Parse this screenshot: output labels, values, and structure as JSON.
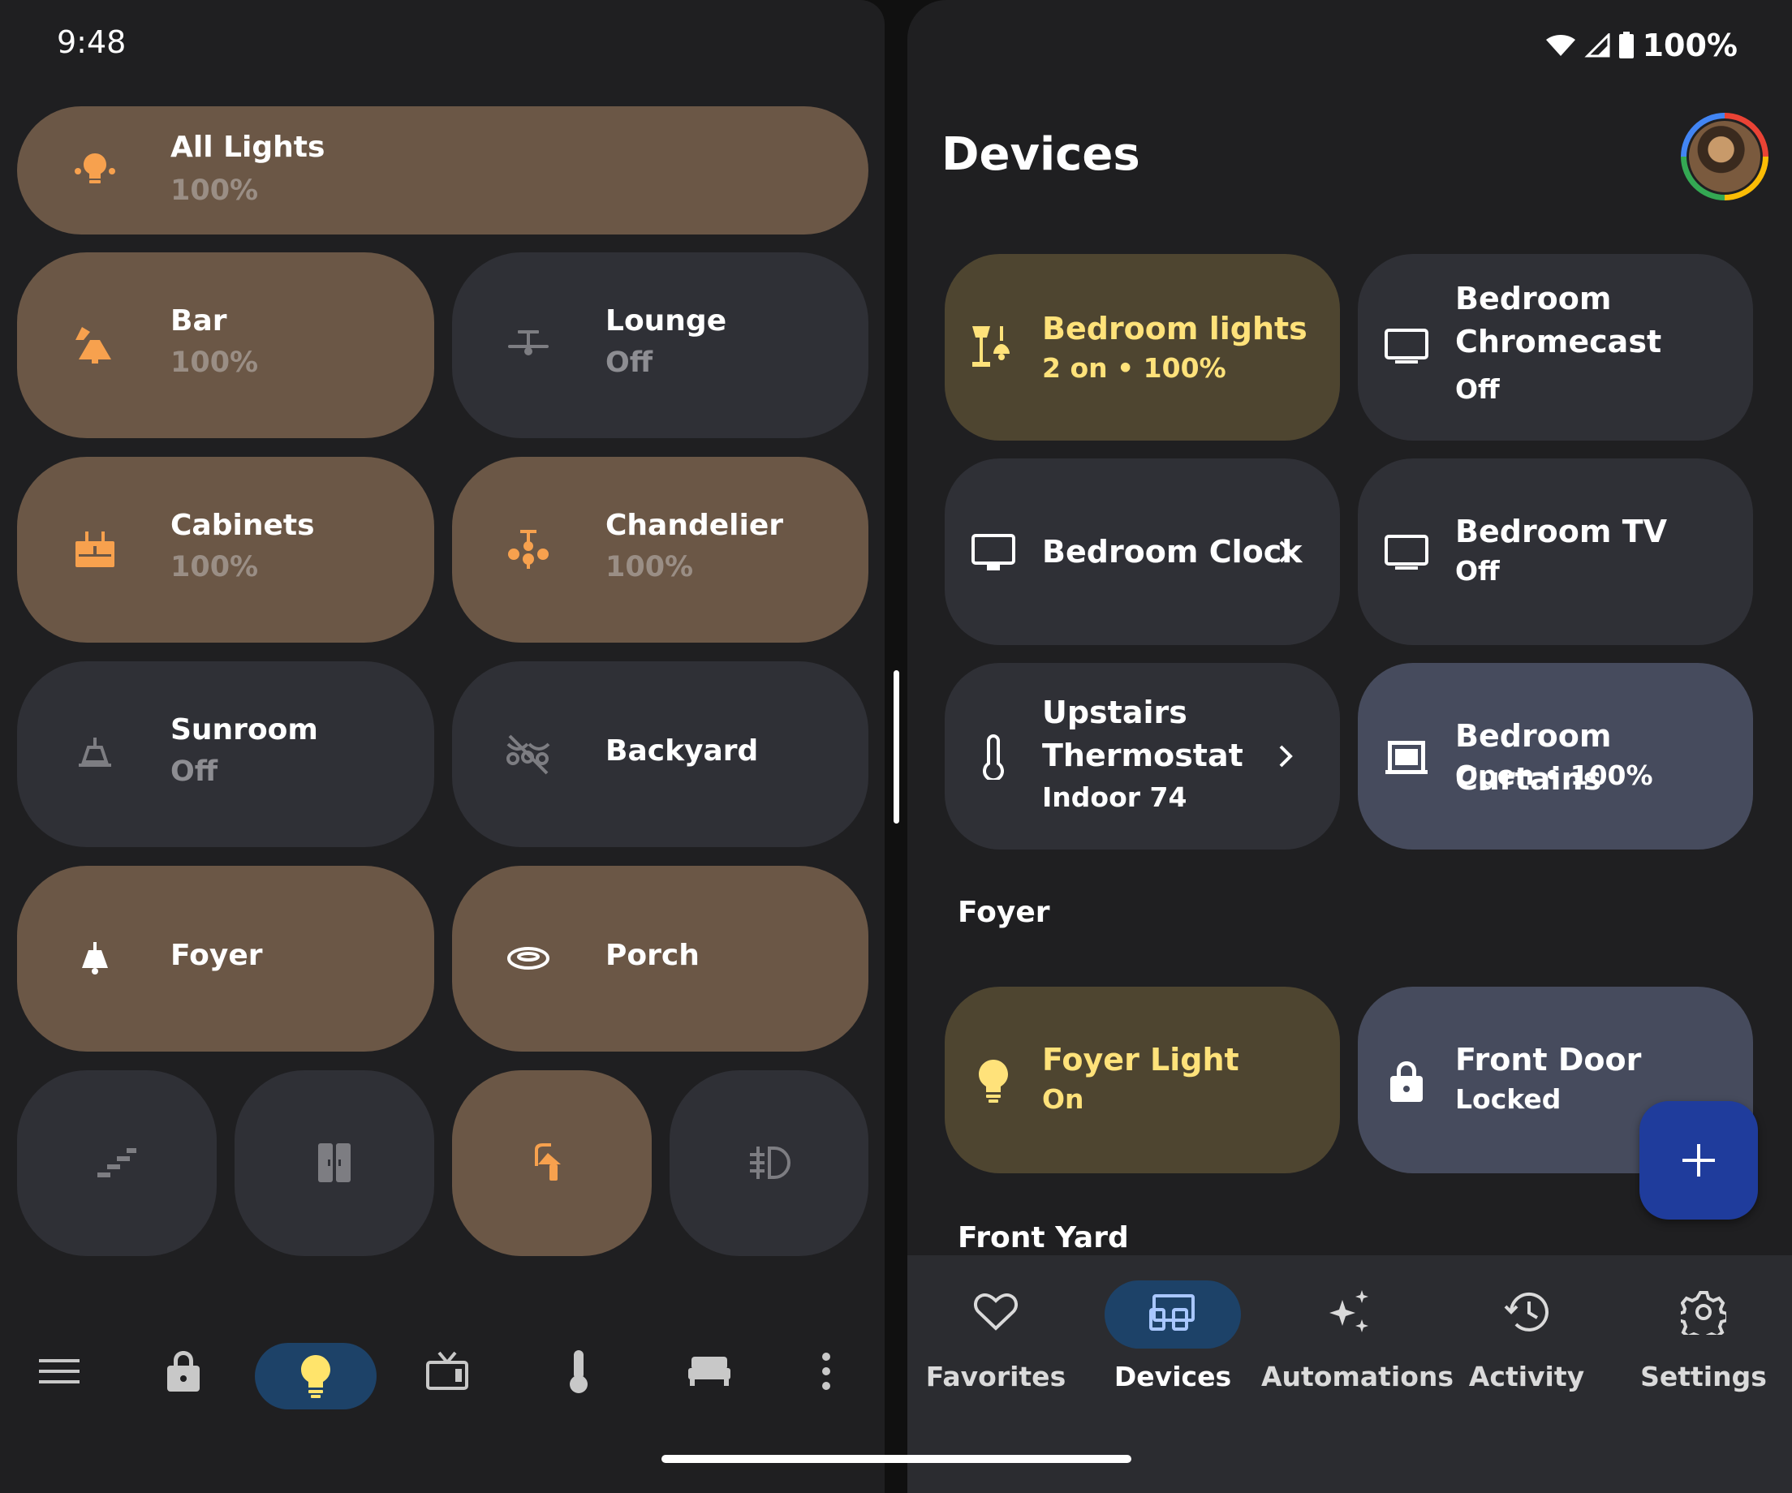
{
  "status": {
    "time": "9:48",
    "battery": "100%"
  },
  "lights": {
    "all": {
      "name": "All Lights",
      "value": "100%"
    },
    "tiles": [
      {
        "name": "Bar",
        "value": "100%"
      },
      {
        "name": "Lounge",
        "value": "Off"
      },
      {
        "name": "Cabinets",
        "value": "100%"
      },
      {
        "name": "Chandelier",
        "value": "100%"
      },
      {
        "name": "Sunroom",
        "value": "Off"
      },
      {
        "name": "Backyard",
        "value": ""
      },
      {
        "name": "Foyer",
        "value": ""
      },
      {
        "name": "Porch",
        "value": ""
      }
    ]
  },
  "devices": {
    "title": "Devices",
    "tiles": [
      {
        "name": "Bedroom lights",
        "sub": "2 on • 100%"
      },
      {
        "name": "Bedroom Chromecast",
        "sub": "Off"
      },
      {
        "name": "Bedroom Clock",
        "sub": ""
      },
      {
        "name": "Bedroom TV",
        "sub": "Off"
      },
      {
        "name": "Upstairs Thermostat",
        "sub": "Indoor 74"
      },
      {
        "name": "Bedroom Curtains",
        "sub": "Open • 100%"
      }
    ],
    "sections": [
      "Foyer",
      "Front Yard"
    ],
    "foyer_tiles": [
      {
        "name": "Foyer Light",
        "sub": "On"
      },
      {
        "name": "Front Door",
        "sub": "Locked"
      }
    ]
  },
  "nav": [
    "Favorites",
    "Devices",
    "Automations",
    "Activity",
    "Settings"
  ],
  "colors": {
    "warm_tile": "#6b5746",
    "dark_tile": "#2f3036",
    "yellow_tile": "#4e4530",
    "blue_tile": "#464b5d",
    "accent_orange": "#f7a14e",
    "accent_yellow": "#ffe27a",
    "active_nav": "#1d4268"
  }
}
